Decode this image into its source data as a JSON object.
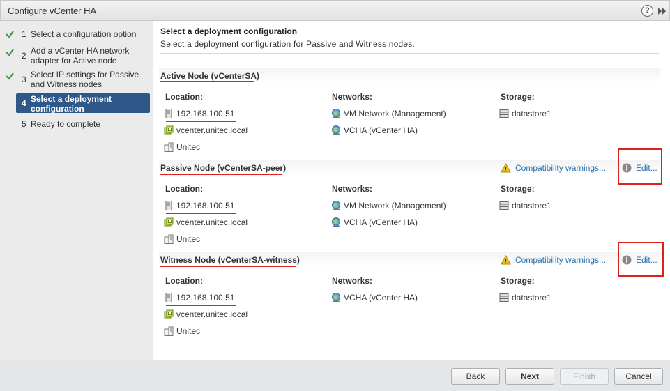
{
  "dialog": {
    "title": "Configure vCenter HA",
    "help": "?"
  },
  "steps": [
    {
      "num": "1",
      "label": "Select a configuration option",
      "done": true
    },
    {
      "num": "2",
      "label": "Add a vCenter HA network adapter for Active node",
      "done": true
    },
    {
      "num": "3",
      "label": "Select IP settings for Passive and Witness nodes",
      "done": true
    },
    {
      "num": "4",
      "label": "Select a deployment configuration",
      "active": true
    },
    {
      "num": "5",
      "label": "Ready to complete"
    }
  ],
  "page": {
    "title": "Select a deployment configuration",
    "subtitle": "Select a deployment configuration for Passive and Witness nodes."
  },
  "labels": {
    "location": "Location:",
    "networks": "Networks:",
    "storage": "Storage:"
  },
  "nodes": [
    {
      "title": "Active Node (vCenterSA)",
      "ip": "192.168.100.51",
      "vcenter": "vcenter.unitec.local",
      "datacenter": "Unitec",
      "networks": [
        "VM Network (Management)",
        "VCHA (vCenter HA)"
      ],
      "storage": "datastore1"
    },
    {
      "title": "Passive Node (vCenterSA-peer)",
      "ip": "192.168.100.51",
      "vcenter": "vcenter.unitec.local",
      "datacenter": "Unitec",
      "networks": [
        "VM Network (Management)",
        "VCHA (vCenter HA)"
      ],
      "storage": "datastore1",
      "warning": "Compatibility warnings...",
      "edit": "Edit..."
    },
    {
      "title": "Witness Node (vCenterSA-witness)",
      "ip": "192.168.100.51",
      "vcenter": "vcenter.unitec.local",
      "datacenter": "Unitec",
      "networks": [
        "VCHA (vCenter HA)"
      ],
      "storage": "datastore1",
      "warning": "Compatibility warnings...",
      "edit": "Edit..."
    }
  ],
  "buttons": {
    "back": "Back",
    "next": "Next",
    "finish": "Finish",
    "cancel": "Cancel"
  },
  "colors": {
    "accent": "#2d5887",
    "link": "#2a6dab",
    "annotation": "#e0201c",
    "check": "#3c9a3c"
  }
}
